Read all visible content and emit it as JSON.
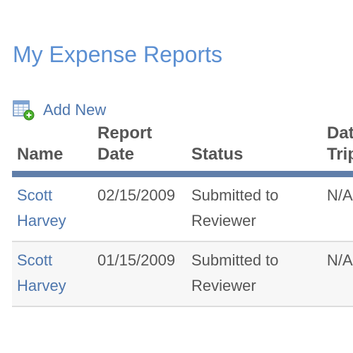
{
  "page": {
    "title": "My Expense Reports"
  },
  "toolbar": {
    "add_new_label": "Add New",
    "add_new_icon": "spreadsheet-add-icon"
  },
  "table": {
    "headers": {
      "name": "Name",
      "report_date": "Report Date",
      "status": "Status",
      "trip_date": "Date of Trip"
    },
    "rows": [
      {
        "name": "Scott Harvey",
        "report_date": "02/15/2009",
        "status": "Submitted to Reviewer",
        "trip_date": "N/A"
      },
      {
        "name": "Scott Harvey",
        "report_date": "01/15/2009",
        "status": "Submitted to Reviewer",
        "trip_date": "N/A"
      }
    ]
  },
  "colors": {
    "title": "#5b8fd2",
    "link": "#4d76ad",
    "header_rule": "#5f7ea9",
    "text": "#555555",
    "row_alt": "#f7f7f7"
  }
}
